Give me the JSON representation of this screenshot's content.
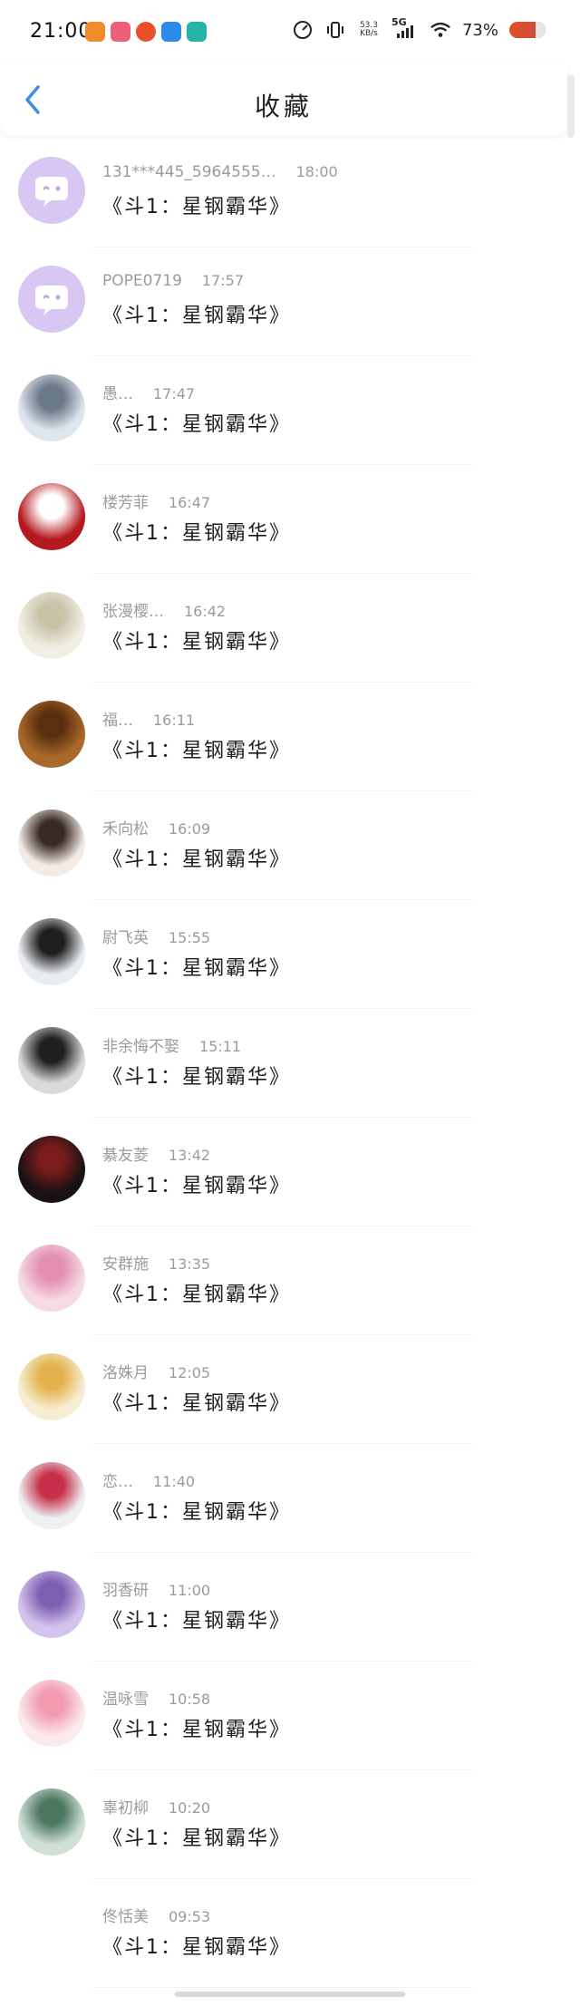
{
  "status_bar": {
    "time": "21:00",
    "speed_top": "53.3",
    "speed_bottom": "KB/s",
    "network": "5G",
    "battery": "73%",
    "battery_level": 0.73
  },
  "header": {
    "title": "收藏"
  },
  "list": [
    {
      "name": "131***445_5964555…",
      "time": "18:00",
      "message": "《斗1：星钢霸华》",
      "avatar": "default"
    },
    {
      "name": "POPE0719",
      "time": "17:57",
      "message": "《斗1：星钢霸华》",
      "avatar": "default"
    },
    {
      "name": "愚…",
      "time": "17:47",
      "message": "《斗1：星钢霸华》",
      "avatar": "photo"
    },
    {
      "name": "楼芳菲",
      "time": "16:47",
      "message": "《斗1：星钢霸华》",
      "avatar": "photo"
    },
    {
      "name": "张漫樱…",
      "time": "16:42",
      "message": "《斗1：星钢霸华》",
      "avatar": "photo"
    },
    {
      "name": "福…",
      "time": "16:11",
      "message": "《斗1：星钢霸华》",
      "avatar": "photo"
    },
    {
      "name": "禾向松",
      "time": "16:09",
      "message": "《斗1：星钢霸华》",
      "avatar": "photo"
    },
    {
      "name": "尉飞英",
      "time": "15:55",
      "message": "《斗1：星钢霸华》",
      "avatar": "photo"
    },
    {
      "name": "非余悔不娶",
      "time": "15:11",
      "message": "《斗1：星钢霸华》",
      "avatar": "photo"
    },
    {
      "name": "綦友菱",
      "time": "13:42",
      "message": "《斗1：星钢霸华》",
      "avatar": "photo"
    },
    {
      "name": "安群施",
      "time": "13:35",
      "message": "《斗1：星钢霸华》",
      "avatar": "photo"
    },
    {
      "name": "洛姝月",
      "time": "12:05",
      "message": "《斗1：星钢霸华》",
      "avatar": "photo"
    },
    {
      "name": "恋…",
      "time": "11:40",
      "message": "《斗1：星钢霸华》",
      "avatar": "photo"
    },
    {
      "name": "羽香研",
      "time": "11:00",
      "message": "《斗1：星钢霸华》",
      "avatar": "photo"
    },
    {
      "name": "温咏雪",
      "time": "10:58",
      "message": "《斗1：星钢霸华》",
      "avatar": "photo"
    },
    {
      "name": "辜初柳",
      "time": "10:20",
      "message": "《斗1：星钢霸华》",
      "avatar": "photo"
    },
    {
      "name": "佟恬美",
      "time": "09:53",
      "message": "《斗1：星钢霸华》",
      "avatar": "none"
    }
  ],
  "icons": {
    "back": "back-chevron-icon",
    "default_avatar": "chat-bubble-avatar-icon",
    "signal": "signal-bars-icon",
    "wifi": "wifi-icon",
    "vibrate": "vibrate-icon",
    "speedometer": "speedometer-icon"
  },
  "colors": {
    "accent": "#3a8ee6",
    "default_avatar_bg": "#d8c7f2",
    "name_gray": "#9b9b9b"
  }
}
